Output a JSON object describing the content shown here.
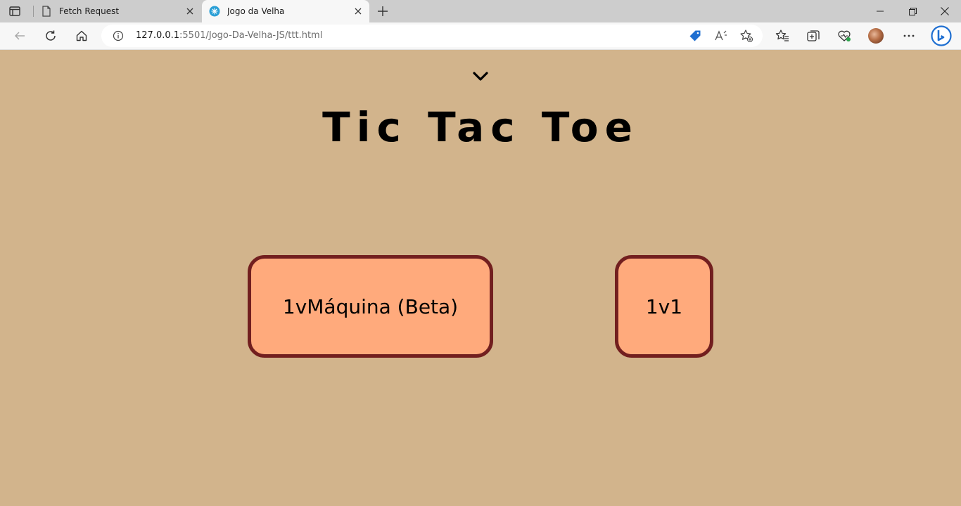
{
  "browser": {
    "tabs": [
      {
        "title": "Fetch Request",
        "active": false,
        "icon": "page-icon"
      },
      {
        "title": "Jogo da Velha",
        "active": true,
        "icon": "dev-server-icon"
      }
    ],
    "address_bar": {
      "url_host": "127.0.0.1",
      "url_rest": ":5501/Jogo-Da-Velha-JS/ttt.html"
    }
  },
  "page": {
    "title": "Tic Tac Toe",
    "buttons": {
      "vs_machine": "1vMáquina (Beta)",
      "one_vs_one": "1v1"
    }
  },
  "colors": {
    "background": "#d2b48c",
    "button_fill": "#ffaa7c",
    "button_border": "#721f1f"
  }
}
